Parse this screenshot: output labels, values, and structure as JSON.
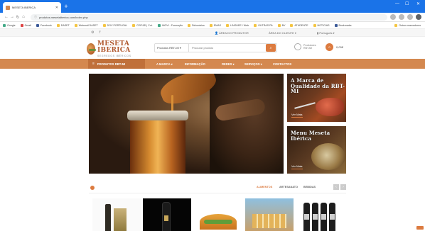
{
  "browser": {
    "tab_title": "MESETA IBERICA",
    "url": "produtos.mesetaiberica.com/index.php",
    "bookmarks": [
      "Google",
      "Gmail",
      "Facebook",
      "DASET",
      "Webmail DASET",
      "DGV PORTUGAL",
      "CEIF&D | Cot.",
      "INOVI - Formação",
      "Dicionários",
      "EMAS",
      "LINGUEE / Web",
      "OUTRAS PA",
      "BV",
      "ATUDENTE",
      "NOTICIAS",
      "Bookmarks"
    ],
    "bookmarks_right": "Outros marcadores"
  },
  "sitebar": {
    "account_area": "ÁREA DO PRODUTOR",
    "client_area": "ÁREA DO CLIENTE",
    "language": "Português"
  },
  "header": {
    "logo_name": "MESETA IBERICA",
    "logo_tagline": "SEGREDOS IBÉRICOS",
    "search_category": "Produtos RBT-MI",
    "search_placeholder": "Procurar produto",
    "compare_label": "Produtores",
    "compare_sub": "RBT-MI",
    "cart_count": "0",
    "cart_total": "0,00€"
  },
  "nav": {
    "products_label": "PRODUTOS RBT-MI",
    "items": [
      "A MARCA",
      "INFORMAÇÃO",
      "REDES",
      "SERVIÇOS",
      "CONTACTOS"
    ]
  },
  "banners": [
    {
      "title": "A Marca de Qualidade da RBT-MI",
      "link": "Ver Mais"
    },
    {
      "title": "Menu Meseta Ibérica",
      "link": "Ver Mais"
    }
  ],
  "product_tabs": [
    "ALIMENTOS",
    "ARTESANATO",
    "BEBIDAS"
  ],
  "colors": {
    "accent": "#dc7b40",
    "nav": "#d4884f",
    "chrome": "#1a73e8"
  }
}
